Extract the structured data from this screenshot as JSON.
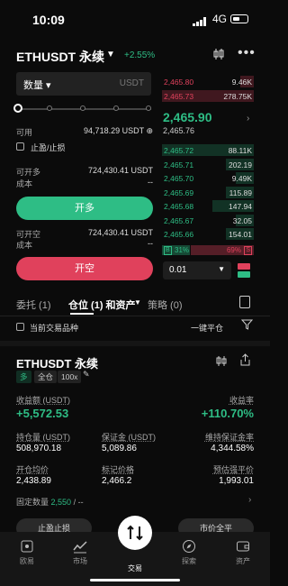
{
  "status": {
    "time": "10:09",
    "network": "4G"
  },
  "header": {
    "title": "ETHUSDT 永续",
    "change": "+2.55%"
  },
  "form": {
    "qty_label": "数量",
    "qty_unit": "USDT",
    "available_label": "可用",
    "available_value": "94,718.29 USDT",
    "tpsl_label": "止盈/止损",
    "can_open_long_label": "可开多",
    "can_open_long_value": "724,430.41 USDT",
    "cost_label": "成本",
    "cost_value": "--",
    "open_long_button": "开多",
    "can_open_short_label": "可开空",
    "can_open_short_value": "724,430.41 USDT",
    "cost2_label": "成本",
    "cost2_value": "--",
    "open_short_button": "开空"
  },
  "orderbook": {
    "asks": [
      {
        "price": "2,465.80",
        "qty": "9.46K",
        "depth": 0.15
      },
      {
        "price": "2,465.73",
        "qty": "278.75K",
        "depth": 1.0
      }
    ],
    "last_price": "2,465.90",
    "mark_price": "2,465.76",
    "bids": [
      {
        "price": "2,465.72",
        "qty": "88.11K",
        "depth": 1.0
      },
      {
        "price": "2,465.71",
        "qty": "202.19",
        "depth": 0.3
      },
      {
        "price": "2,465.70",
        "qty": "9.49K",
        "depth": 0.2
      },
      {
        "price": "2,465.69",
        "qty": "115.89",
        "depth": 0.3
      },
      {
        "price": "2,465.68",
        "qty": "147.94",
        "depth": 0.45
      },
      {
        "price": "2,465.67",
        "qty": "32.05",
        "depth": 0.2
      },
      {
        "price": "2,465.66",
        "qty": "154.01",
        "depth": 0.3
      }
    ],
    "buy_label": "B",
    "buy_pct": "31%",
    "sell_pct": "69%",
    "sell_label": "S",
    "depth_value": "0.01"
  },
  "tabs": {
    "orders": "委托 (1)",
    "positions": "仓位 (1) 和资产",
    "strategy": "策略 (0)"
  },
  "filters": {
    "current_symbol": "当前交易品种",
    "close_all": "一键平仓"
  },
  "position": {
    "title": "ETHUSDT 永续",
    "direction": "多",
    "margin_mode": "全仓",
    "leverage": "100x",
    "pnl_label": "收益额 (USDT)",
    "pnl_value": "+5,572.53",
    "roe_label": "收益率",
    "roe_value": "+110.70%",
    "size_label": "持仓量 (USDT)",
    "size_value": "508,970.18",
    "margin_label": "保证金 (USDT)",
    "margin_value": "5,089.86",
    "mmr_label": "维持保证金率",
    "mmr_value": "4,344.58%",
    "entry_label": "开仓均价",
    "entry_value": "2,438.89",
    "mark_label": "标记价格",
    "mark_value": "2,466.2",
    "liq_label": "预估强平价",
    "liq_value": "1,993.01",
    "fixed_label": "固定数量",
    "fixed_value": "2,550",
    "fixed_suffix": "/ --",
    "tpsl_button": "止盈止损",
    "close_button": "市价全平"
  },
  "nav": [
    {
      "label": "欧易",
      "icon": "home-icon"
    },
    {
      "label": "市场",
      "icon": "market-chart-icon"
    },
    {
      "label": "交易",
      "icon": "trade-swap-icon"
    },
    {
      "label": "探索",
      "icon": "compass-icon"
    },
    {
      "label": "资产",
      "icon": "wallet-icon"
    }
  ],
  "colors": {
    "green": "#2ebd85",
    "red": "#e0415c",
    "background": "#0b0b0b"
  }
}
